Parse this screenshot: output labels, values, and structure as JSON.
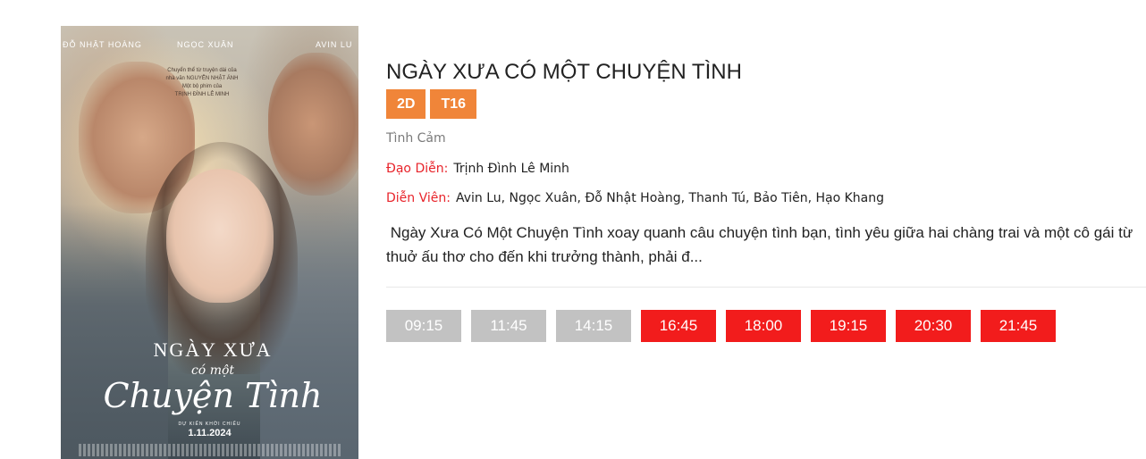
{
  "poster": {
    "names": [
      "ĐỖ NHẬT HOÀNG",
      "NGỌC XUÂN",
      "AVIN LU"
    ],
    "credit_lines": [
      "Chuyển thể từ truyện dài của",
      "nhà văn NGUYỄN NHẬT ÁNH",
      "Một bộ phim của",
      "TRỊNH ĐÌNH LÊ MINH"
    ],
    "title_top": "NGÀY XƯA",
    "title_mid": "có một",
    "title_main": "Chuyện Tình",
    "release_caption": "DỰ KIẾN KHỞI CHIẾU",
    "release_date": "1.11.2024"
  },
  "movie": {
    "title": "NGÀY XƯA CÓ MỘT CHUYỆN TÌNH",
    "tags": [
      "2D",
      "T16"
    ],
    "genre": "Tình Cảm",
    "director_label": "Đạo Diễn:",
    "director": "Trịnh Đình Lê Minh",
    "cast_label": "Diễn Viên:",
    "cast": "Avin Lu, Ngọc Xuân, Đỗ Nhật Hoàng, Thanh Tú, Bảo Tiên, Hạo Khang",
    "summary": " Ngày Xưa Có Một Chuyện Tình xoay quanh câu chuyện tình bạn, tình yêu giữa hai chàng trai và một cô gái từ thuở ấu thơ cho đến khi trưởng thành, phải đ..."
  },
  "showtimes": [
    {
      "time": "09:15",
      "status": "past"
    },
    {
      "time": "11:45",
      "status": "past"
    },
    {
      "time": "14:15",
      "status": "past"
    },
    {
      "time": "16:45",
      "status": "available"
    },
    {
      "time": "18:00",
      "status": "available"
    },
    {
      "time": "19:15",
      "status": "available"
    },
    {
      "time": "20:30",
      "status": "available"
    },
    {
      "time": "21:45",
      "status": "available"
    }
  ],
  "colors": {
    "tag": "#f08539",
    "label_red": "#e8242b",
    "showtime_available": "#f21c1c",
    "showtime_past": "#c2c2c2"
  }
}
